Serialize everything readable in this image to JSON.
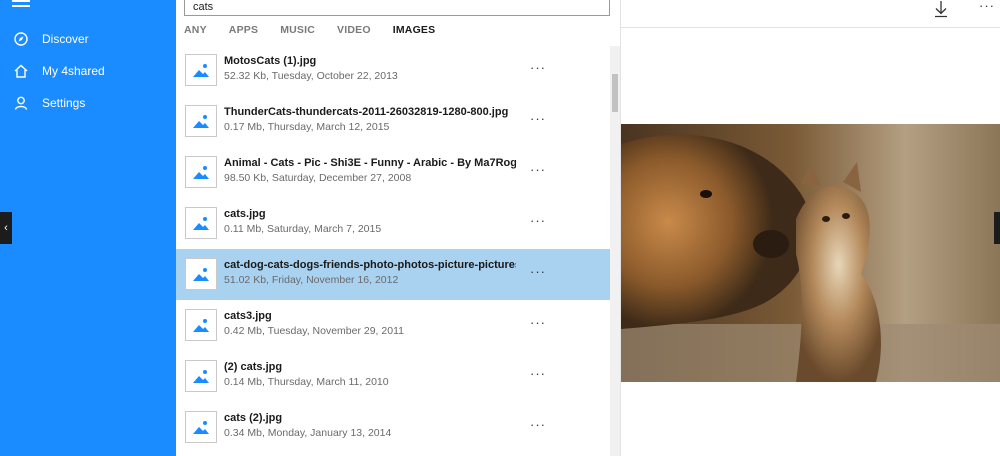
{
  "sidebar": {
    "items": [
      {
        "label": "Discover",
        "icon": "discover-icon"
      },
      {
        "label": "My 4shared",
        "icon": "home-icon"
      },
      {
        "label": "Settings",
        "icon": "user-icon"
      }
    ]
  },
  "search": {
    "value": "cats"
  },
  "filters": [
    {
      "label": "ANY",
      "active": false
    },
    {
      "label": "APPS",
      "active": false
    },
    {
      "label": "MUSIC",
      "active": false
    },
    {
      "label": "VIDEO",
      "active": false
    },
    {
      "label": "IMAGES",
      "active": true
    }
  ],
  "results": [
    {
      "name": "MotosCats (1).jpg",
      "meta": "52.32 Kb, Tuesday, October 22, 2013"
    },
    {
      "name": "ThunderCats-thundercats-2011-26032819-1280-800.jpg",
      "meta": "0.17 Mb, Thursday, March 12, 2015"
    },
    {
      "name": "Animal - Cats - Pic - Shi3E - Funny - Arabic - By Ma7Rog",
      "meta": "98.50 Kb, Saturday, December 27, 2008"
    },
    {
      "name": "cats.jpg",
      "meta": "0.11 Mb, Saturday, March 7, 2015"
    },
    {
      "name": "cat-dog-cats-dogs-friends-photo-photos-picture-pictures",
      "meta": "51.02 Kb, Friday, November 16, 2012"
    },
    {
      "name": "cats3.jpg",
      "meta": "0.42 Mb, Tuesday, November 29, 2011"
    },
    {
      "name": "(2) cats.jpg",
      "meta": "0.14 Mb, Thursday, March 11, 2010"
    },
    {
      "name": "cats (2).jpg",
      "meta": "0.34 Mb, Monday, January 13, 2014"
    }
  ],
  "selected_index": 4,
  "more_glyph": "···",
  "colors": {
    "sidebar": "#1a8cff",
    "selected_row": "#a9d1f0"
  }
}
